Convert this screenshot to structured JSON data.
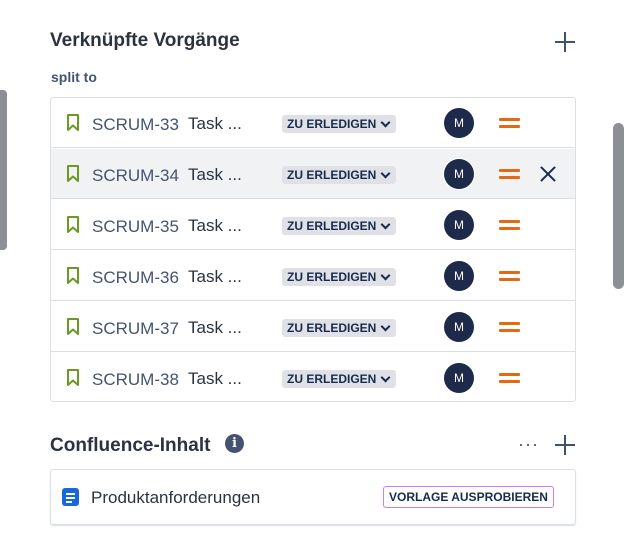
{
  "linked_issues": {
    "title": "Verknüpfte Vorgänge",
    "relation": "split to",
    "items": [
      {
        "key": "SCRUM-33",
        "summary": "Task ...",
        "status": "ZU ERLEDIGEN",
        "assignee_initial": "M"
      },
      {
        "key": "SCRUM-34",
        "summary": "Task ...",
        "status": "ZU ERLEDIGEN",
        "assignee_initial": "M"
      },
      {
        "key": "SCRUM-35",
        "summary": "Task ...",
        "status": "ZU ERLEDIGEN",
        "assignee_initial": "M"
      },
      {
        "key": "SCRUM-36",
        "summary": "Task ...",
        "status": "ZU ERLEDIGEN",
        "assignee_initial": "M"
      },
      {
        "key": "SCRUM-37",
        "summary": "Task ...",
        "status": "ZU ERLEDIGEN",
        "assignee_initial": "M"
      },
      {
        "key": "SCRUM-38",
        "summary": "Task ...",
        "status": "ZU ERLEDIGEN",
        "assignee_initial": "M"
      }
    ]
  },
  "confluence": {
    "title": "Confluence-Inhalt",
    "info_glyph": "i",
    "more_glyph": "···",
    "page_label": "Produktanforderungen",
    "try_button": "VORLAGE AUSPROBIEREN"
  },
  "icons": {
    "issue_type": "bookmark-icon",
    "priority": "priority-medium-icon",
    "remove": "close-icon",
    "add": "plus-icon",
    "page": "page-icon"
  },
  "colors": {
    "story_green": "#6a9a23",
    "priority_orange": "#e56910",
    "avatar_navy": "#1d2a4a",
    "page_blue": "#1868db",
    "try_border": "#c97cf4"
  }
}
